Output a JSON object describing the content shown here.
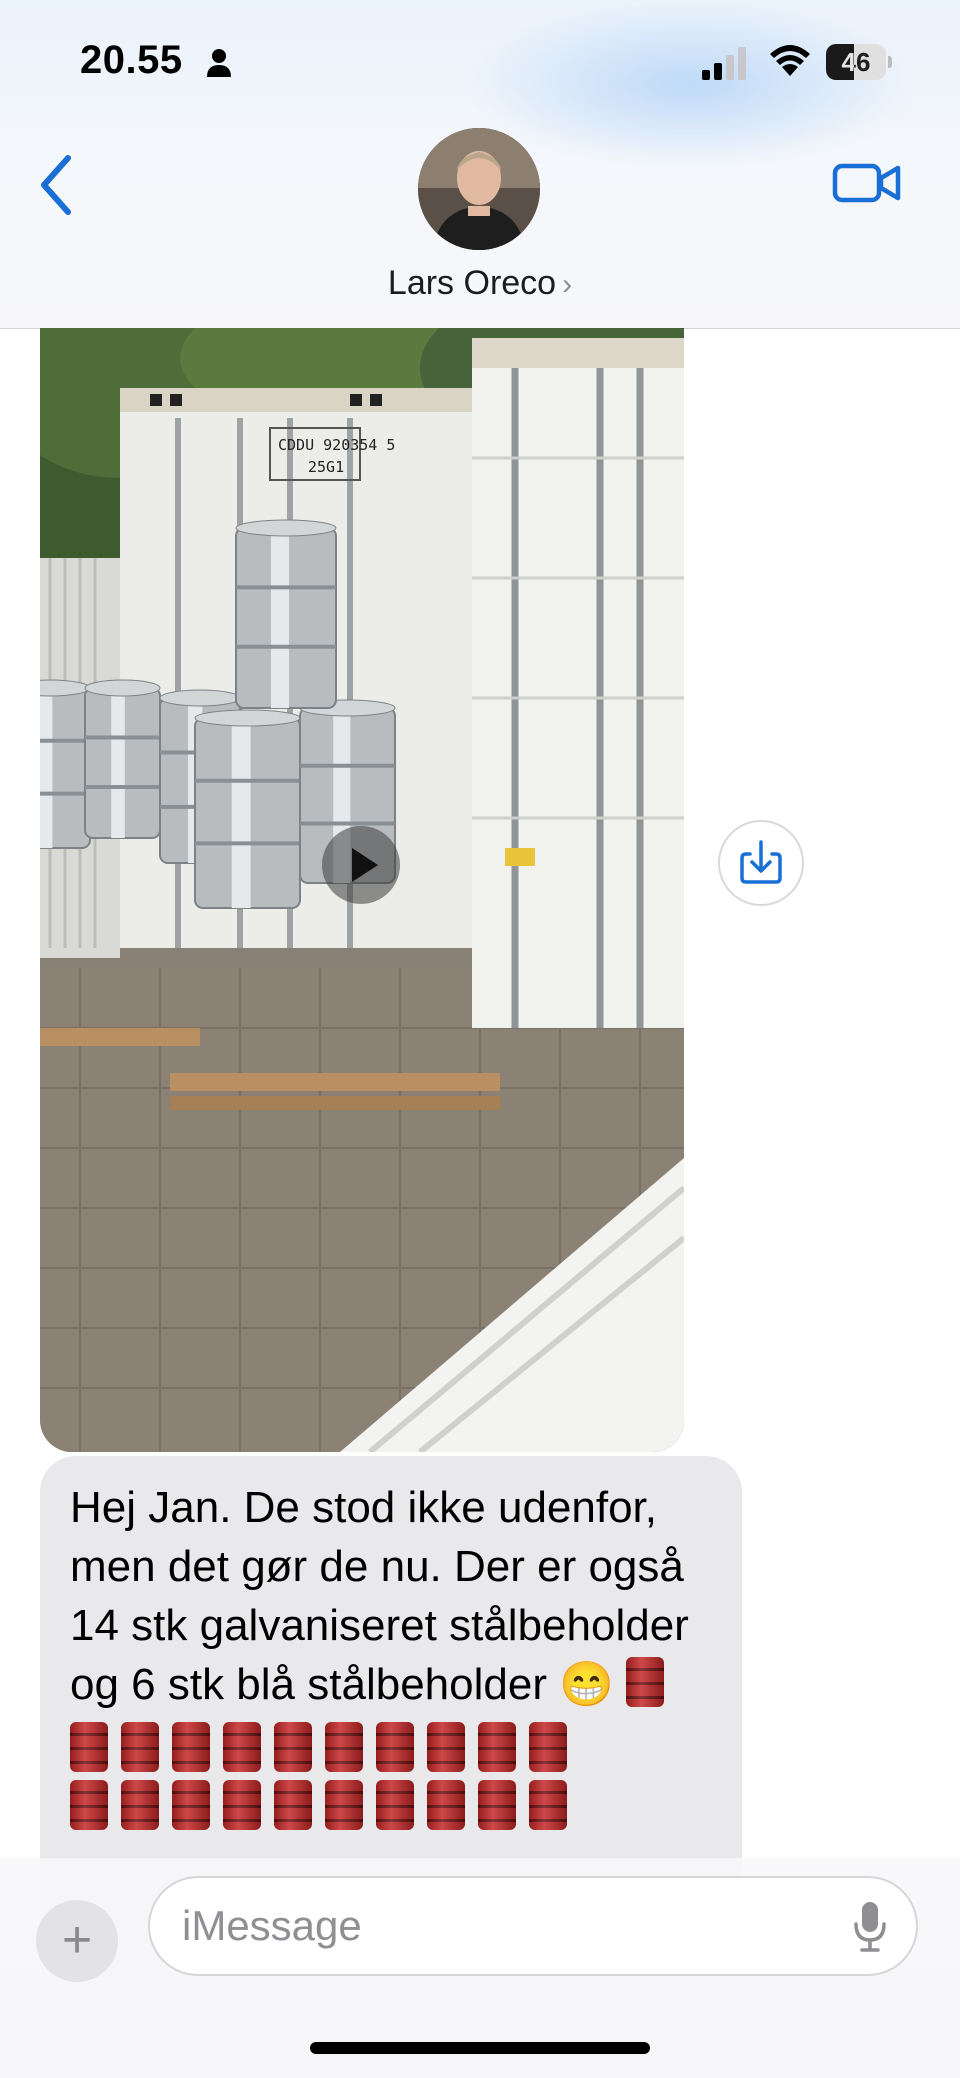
{
  "status_bar": {
    "time": "20.55",
    "battery_level": "46",
    "battery_fraction": 0.46
  },
  "header": {
    "contact_name": "Lars Oreco",
    "back_icon": "chevron-left-icon",
    "video_icon": "video-camera-icon",
    "name_chevron": "chevron-right-icon"
  },
  "media": {
    "container_text_line1": "CDDU 920354 5",
    "container_text_line2": "25G1",
    "play_icon": "play-icon",
    "save_icon": "download-icon"
  },
  "message": {
    "text": "Hej Jan. De stod ikke udenfor, men det gør de nu. Der er også 14 stk galvaniseret stålbeholder og 6 stk blå stålbeholder 😁",
    "emoji_icon": "oil-drum-emoji-icon"
  },
  "composer": {
    "placeholder": "iMessage",
    "plus_label": "+",
    "mic_icon": "microphone-icon"
  },
  "colors": {
    "accent": "#1a6fd6",
    "bubble_received": "#e9e9eb"
  }
}
